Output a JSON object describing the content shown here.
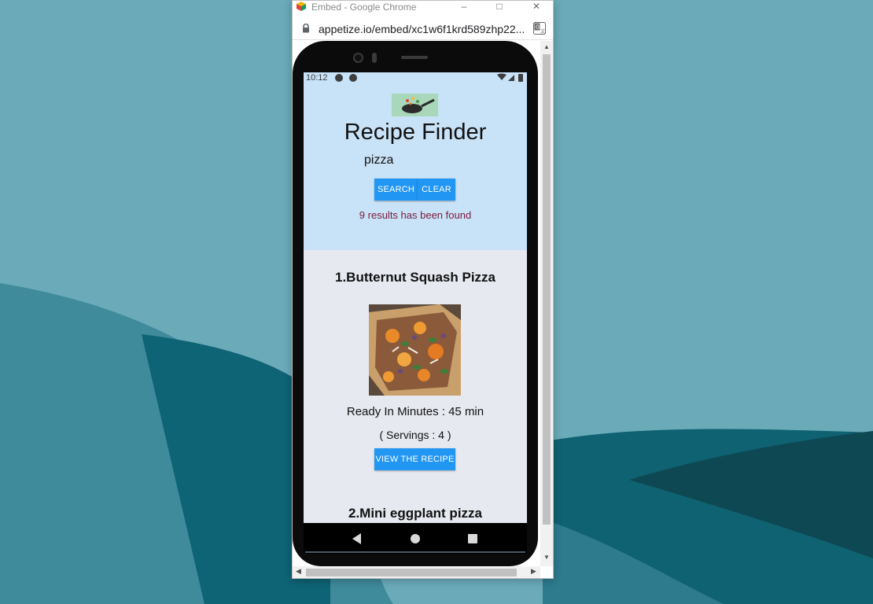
{
  "window": {
    "title": "Embed - Google Chrome",
    "url": "appetize.io/embed/xc1w6f1krd589zhp22..."
  },
  "colors": {
    "header_bg": "#c8e2f7",
    "content_bg": "#e6e9ef",
    "button": "#2196f3",
    "results_text": "#7a1b3c"
  },
  "phone": {
    "status_time": "10:12"
  },
  "app": {
    "title": "Recipe Finder",
    "search_value": "pizza",
    "search_button": "SEARCH",
    "clear_button": "CLEAR",
    "results_text": "9 results has been found"
  },
  "recipes": [
    {
      "title": "1.Butternut Squash Pizza",
      "ready": "Ready In Minutes : 45 min",
      "servings": "( Servings : 4 )",
      "view_button": "VIEW THE RECIPE"
    },
    {
      "title": "2.Mini eggplant pizza"
    }
  ],
  "icons": {
    "app_icon": "chrome-app-icon",
    "lock": "lock-icon",
    "translate": "translate-icon",
    "nav_back": "back-triangle",
    "nav_home": "home-circle",
    "nav_recent": "recents-square"
  }
}
